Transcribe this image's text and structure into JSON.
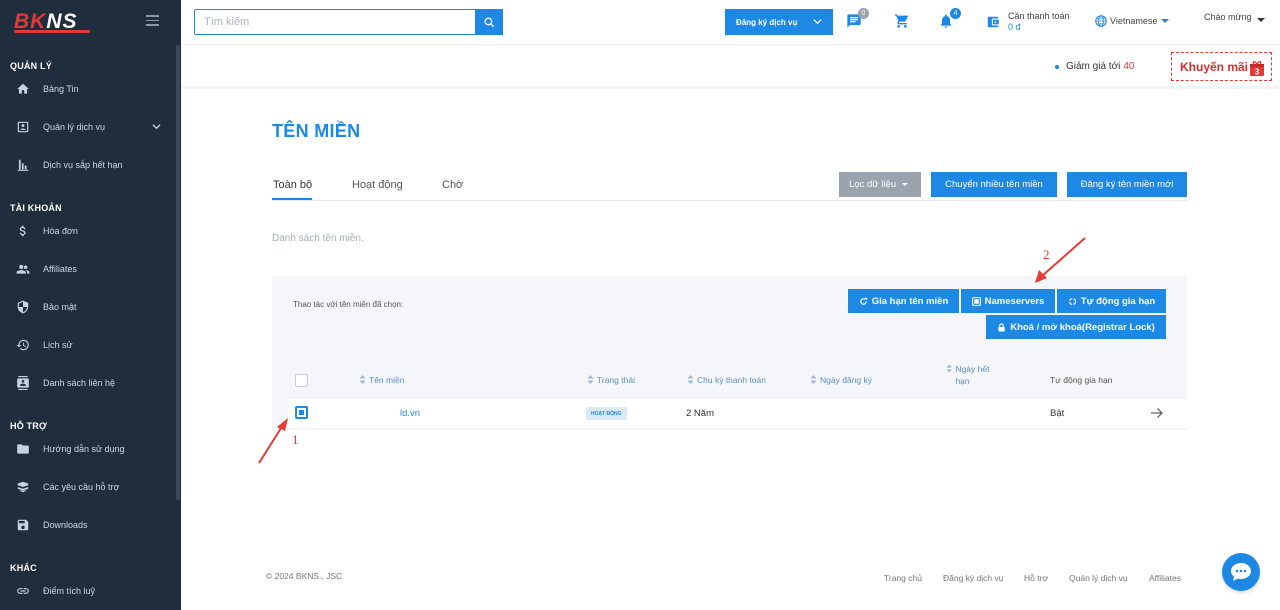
{
  "brand": {
    "logo_text_a": "BK",
    "logo_text_b": "NS"
  },
  "sidebar": {
    "sections": [
      {
        "title": "QUẢN LÝ",
        "items": [
          {
            "label": "Bảng Tin",
            "icon": "home-icon"
          },
          {
            "label": "Quản lý dịch vụ",
            "icon": "id-card-icon"
          },
          {
            "label": "Dịch vụ sắp hết hạn",
            "icon": "bar-chart-icon"
          }
        ]
      },
      {
        "title": "TÀI KHOẢN",
        "items": [
          {
            "label": "Hóa đơn",
            "icon": "dollar-icon"
          },
          {
            "label": "Affiliates",
            "icon": "users-icon"
          },
          {
            "label": "Bảo mật",
            "icon": "shield-icon"
          },
          {
            "label": "Lịch sử",
            "icon": "history-icon"
          },
          {
            "label": "Danh sách liên hệ",
            "icon": "contact-icon"
          }
        ]
      },
      {
        "title": "HỖ TRỢ",
        "items": [
          {
            "label": "Hướng dẫn sử dụng",
            "icon": "folder-icon"
          },
          {
            "label": "Các yêu cầu hỗ trợ",
            "icon": "ticket-icon"
          },
          {
            "label": "Downloads",
            "icon": "save-icon"
          }
        ]
      },
      {
        "title": "KHÁC",
        "items": [
          {
            "label": "Điểm tích luỹ",
            "icon": "link-icon"
          }
        ]
      }
    ]
  },
  "topbar": {
    "search_placeholder": "Tìm kiếm",
    "service_button": "Đăng ký dịch vụ",
    "message_count": "0",
    "notification_count": "4",
    "payment_label": "Cần thanh toán",
    "payment_value": "0 đ",
    "language": "Vietnamese",
    "greeting": "Chào mừng"
  },
  "promo": {
    "text": "Giảm giá tới",
    "number": "40",
    "button": "Khuyến mãi",
    "gift_count": "3"
  },
  "main": {
    "title": "TÊN MIỀN",
    "tabs": [
      "Toàn bộ",
      "Hoạt động",
      "Chờ"
    ],
    "filter_button": "Lọc dữ liệu",
    "transfer_button": "Chuyển nhiều tên miền",
    "register_button": "Đăng ký tên miền mới",
    "description": "Danh sách tên miền.",
    "bulk_label": "Thao tác với tên miền đã chọn:",
    "actions": {
      "renew": "Gia hạn tên miền",
      "nameservers": "Nameservers",
      "auto_renew": "Tự động gia hạn",
      "lock": "Khoá / mở khoá(Registrar Lock)"
    },
    "table": {
      "headers": [
        "Tên miền",
        "Trạng thái",
        "Chu kỳ thanh toán",
        "Ngày đăng ký",
        "Ngày hết hạn",
        "Tự động gia hạn"
      ],
      "rows": [
        {
          "domain": "ld.vn",
          "status": "HOẠT ĐỘNG",
          "cycle": "2 Năm",
          "registered": "",
          "expires": "",
          "auto_renew": "Bật"
        }
      ]
    },
    "annotations": [
      "1",
      "2"
    ]
  },
  "footer": {
    "copyright": "© 2024 BKNS., JSC",
    "links": [
      "Trang chủ",
      "Đăng ký dịch vụ",
      "Hỗ trợ",
      "Quản lý dịch vụ",
      "Affiliates"
    ]
  },
  "colors": {
    "accent": "#1e88e5",
    "sidebar": "#1f2d3d",
    "brand_red": "#e53935"
  }
}
